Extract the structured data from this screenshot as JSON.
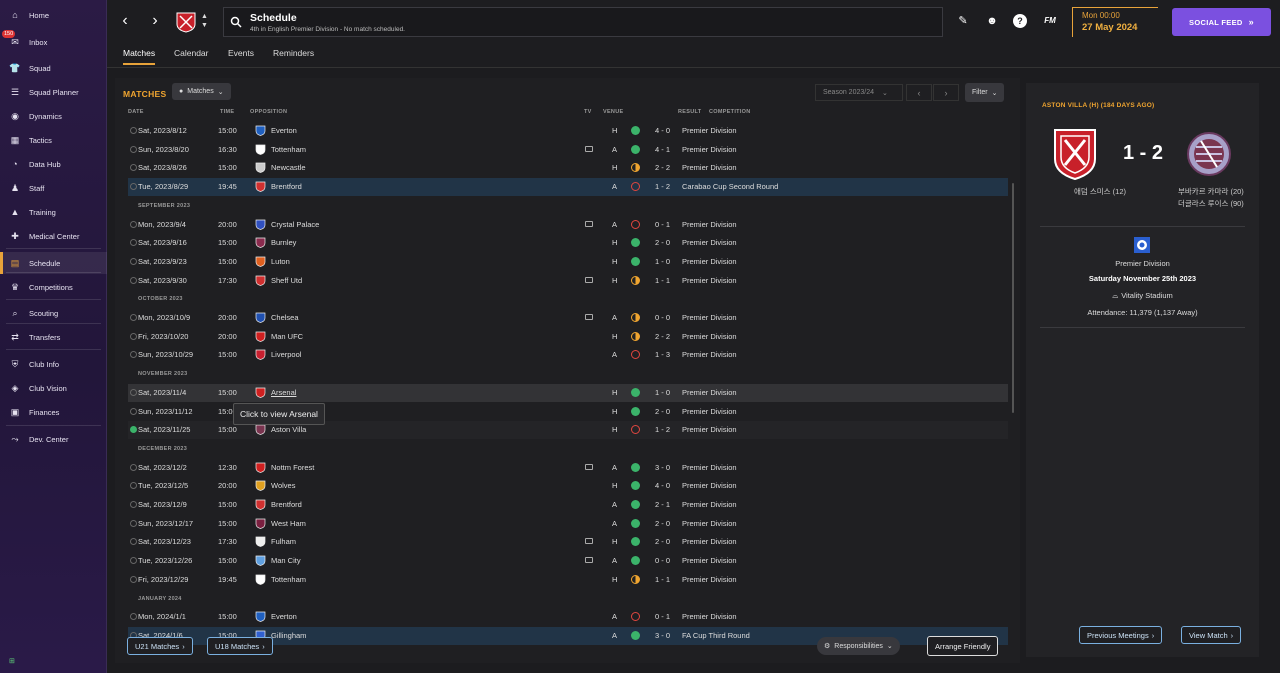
{
  "sidebar": {
    "items": [
      {
        "label": "Home",
        "icon": "home-icon"
      },
      {
        "label": "Inbox",
        "icon": "inbox-icon"
      },
      {
        "label": "Squad",
        "icon": "shirt-icon"
      },
      {
        "label": "Squad Planner",
        "icon": "planner-icon"
      },
      {
        "label": "Dynamics",
        "icon": "dynamics-icon"
      },
      {
        "label": "Tactics",
        "icon": "tactics-icon"
      },
      {
        "label": "Data Hub",
        "icon": "data-icon"
      },
      {
        "label": "Staff",
        "icon": "staff-icon"
      },
      {
        "label": "Training",
        "icon": "training-icon"
      },
      {
        "label": "Medical Center",
        "icon": "medical-icon"
      },
      {
        "label": "Schedule",
        "icon": "calendar-icon"
      },
      {
        "label": "Competitions",
        "icon": "trophy-icon"
      },
      {
        "label": "Scouting",
        "icon": "scouting-icon"
      },
      {
        "label": "Transfers",
        "icon": "transfers-icon"
      },
      {
        "label": "Club Info",
        "icon": "shield-icon"
      },
      {
        "label": "Club Vision",
        "icon": "vision-icon"
      },
      {
        "label": "Finances",
        "icon": "finances-icon"
      },
      {
        "label": "Dev. Center",
        "icon": "dev-icon"
      }
    ],
    "inbox_badge": "150",
    "bottom_label": "⊞"
  },
  "topbar": {
    "title": "Schedule",
    "subtitle": "4th in English Premier Division - No match scheduled.",
    "time": "Mon 00:00",
    "date": "27 May 2024",
    "fm_label": "FM",
    "social_feed": "SOCIAL FEED"
  },
  "subtabs": [
    "Matches",
    "Calendar",
    "Events",
    "Reminders"
  ],
  "panel": {
    "title": "MATCHES",
    "matches_dropdown": "Matches",
    "season": "Season 2023/24",
    "filter": "Filter",
    "headers": {
      "date": "DATE",
      "time": "TIME",
      "opposition": "OPPOSITION",
      "tv": "TV",
      "venue": "VENUE",
      "result": "RESULT",
      "competition": "COMPETITION"
    },
    "tooltip": "Click to view Arsenal",
    "u21": "U21 Matches",
    "u18": "U18 Matches",
    "responsibilities": "Responsibilities",
    "arrange_friendly": "Arrange Friendly"
  },
  "colors": {
    "accent": "#f0a530",
    "win": "#3bb36a",
    "loss": "#e0463f",
    "draw": "#f0a530",
    "social": "#7b50e0"
  },
  "rows": [
    {
      "date": "Sat, 2023/8/12",
      "time": "15:00",
      "opp": "Everton",
      "tv": false,
      "venue": "H",
      "res": "W",
      "score": "4 - 0",
      "comp": "Premier Division",
      "crest": "#2060c0"
    },
    {
      "date": "Sun, 2023/8/20",
      "time": "16:30",
      "opp": "Tottenham",
      "tv": true,
      "venue": "A",
      "res": "W",
      "score": "4 - 1",
      "comp": "Premier Division",
      "crest": "#ffffff"
    },
    {
      "date": "Sat, 2023/8/26",
      "time": "15:00",
      "opp": "Newcastle",
      "tv": false,
      "venue": "H",
      "res": "D",
      "score": "2 - 2",
      "comp": "Premier Division",
      "crest": "#cccccc"
    },
    {
      "date": "Tue, 2023/8/29",
      "time": "19:45",
      "opp": "Brentford",
      "tv": false,
      "venue": "A",
      "res": "L",
      "score": "1 - 2",
      "comp": "Carabao Cup Second Round",
      "crest": "#d03030",
      "hl": true
    },
    {
      "month": "SEPTEMBER 2023"
    },
    {
      "date": "Mon, 2023/9/4",
      "time": "20:00",
      "opp": "Crystal Palace",
      "tv": true,
      "venue": "A",
      "res": "L",
      "score": "0 - 1",
      "comp": "Premier Division",
      "crest": "#3050c0"
    },
    {
      "date": "Sat, 2023/9/16",
      "time": "15:00",
      "opp": "Burnley",
      "tv": false,
      "venue": "H",
      "res": "W",
      "score": "2 - 0",
      "comp": "Premier Division",
      "crest": "#8a2b4e"
    },
    {
      "date": "Sat, 2023/9/23",
      "time": "15:00",
      "opp": "Luton",
      "tv": false,
      "venue": "H",
      "res": "W",
      "score": "1 - 0",
      "comp": "Premier Division",
      "crest": "#e06020"
    },
    {
      "date": "Sat, 2023/9/30",
      "time": "17:30",
      "opp": "Sheff Utd",
      "tv": true,
      "venue": "H",
      "res": "D",
      "score": "1 - 1",
      "comp": "Premier Division",
      "crest": "#d03030"
    },
    {
      "month": "OCTOBER 2023"
    },
    {
      "date": "Mon, 2023/10/9",
      "time": "20:00",
      "opp": "Chelsea",
      "tv": true,
      "venue": "A",
      "res": "D",
      "score": "0 - 0",
      "comp": "Premier Division",
      "crest": "#2050b0"
    },
    {
      "date": "Fri, 2023/10/20",
      "time": "20:00",
      "opp": "Man UFC",
      "tv": false,
      "venue": "H",
      "res": "D",
      "score": "2 - 2",
      "comp": "Premier Division",
      "crest": "#d02020"
    },
    {
      "date": "Sun, 2023/10/29",
      "time": "15:00",
      "opp": "Liverpool",
      "tv": false,
      "venue": "A",
      "res": "L",
      "score": "1 - 3",
      "comp": "Premier Division",
      "crest": "#c82030"
    },
    {
      "month": "NOVEMBER 2023"
    },
    {
      "date": "Sat, 2023/11/4",
      "time": "15:00",
      "opp": "Arsenal",
      "tv": false,
      "venue": "H",
      "res": "W",
      "score": "1 - 0",
      "comp": "Premier Division",
      "crest": "#d02020",
      "link": true,
      "hover": true
    },
    {
      "date": "Sun, 2023/11/12",
      "time": "15:00",
      "opp": "",
      "tv": false,
      "venue": "H",
      "res": "W",
      "score": "2 - 0",
      "comp": "Premier Division",
      "crest": ""
    },
    {
      "date": "Sat, 2023/11/25",
      "time": "15:00",
      "opp": "Aston Villa",
      "tv": false,
      "venue": "H",
      "res": "L",
      "score": "1 - 2",
      "comp": "Premier Division",
      "crest": "#7a3550",
      "done": true,
      "striped": true
    },
    {
      "month": "DECEMBER 2023"
    },
    {
      "date": "Sat, 2023/12/2",
      "time": "12:30",
      "opp": "Nottm Forest",
      "tv": true,
      "venue": "A",
      "res": "W",
      "score": "3 - 0",
      "comp": "Premier Division",
      "crest": "#d02020"
    },
    {
      "date": "Tue, 2023/12/5",
      "time": "20:00",
      "opp": "Wolves",
      "tv": false,
      "venue": "H",
      "res": "W",
      "score": "4 - 0",
      "comp": "Premier Division",
      "crest": "#e0a020"
    },
    {
      "date": "Sat, 2023/12/9",
      "time": "15:00",
      "opp": "Brentford",
      "tv": false,
      "venue": "A",
      "res": "W",
      "score": "2 - 1",
      "comp": "Premier Division",
      "crest": "#d03030"
    },
    {
      "date": "Sun, 2023/12/17",
      "time": "15:00",
      "opp": "West Ham",
      "tv": false,
      "venue": "A",
      "res": "W",
      "score": "2 - 0",
      "comp": "Premier Division",
      "crest": "#7a2040"
    },
    {
      "date": "Sat, 2023/12/23",
      "time": "17:30",
      "opp": "Fulham",
      "tv": true,
      "venue": "H",
      "res": "W",
      "score": "2 - 0",
      "comp": "Premier Division",
      "crest": "#eeeeee"
    },
    {
      "date": "Tue, 2023/12/26",
      "time": "15:00",
      "opp": "Man City",
      "tv": true,
      "venue": "A",
      "res": "W",
      "score": "0 - 0",
      "comp": "Premier Division",
      "crest": "#60a0e0"
    },
    {
      "date": "Fri, 2023/12/29",
      "time": "19:45",
      "opp": "Tottenham",
      "tv": false,
      "venue": "H",
      "res": "D",
      "score": "1 - 1",
      "comp": "Premier Division",
      "crest": "#ffffff"
    },
    {
      "month": "JANUARY 2024"
    },
    {
      "date": "Mon, 2024/1/1",
      "time": "15:00",
      "opp": "Everton",
      "tv": false,
      "venue": "A",
      "res": "L",
      "score": "0 - 1",
      "comp": "Premier Division",
      "crest": "#2060c0"
    },
    {
      "date": "Sat, 2024/1/6",
      "time": "15:00",
      "opp": "Gillingham",
      "tv": false,
      "venue": "A",
      "res": "W",
      "score": "3 - 0",
      "comp": "FA Cup Third Round",
      "crest": "#3060d0",
      "hl": true
    }
  ],
  "match_detail": {
    "title": "ASTON VILLA (H) (184 DAYS AGO)",
    "score": "1 - 2",
    "home_scorer": "애덤 스미스 (12)",
    "away_scorers": [
      "부바카르 카마라 (20)",
      "더글라스 루이스 (90)"
    ],
    "competition": "Premier Division",
    "date": "Saturday November 25th 2023",
    "stadium": "Vitality Stadium",
    "attendance": "Attendance: 11,379 (1,137 Away)",
    "previous_meetings": "Previous Meetings",
    "view_match": "View Match"
  }
}
